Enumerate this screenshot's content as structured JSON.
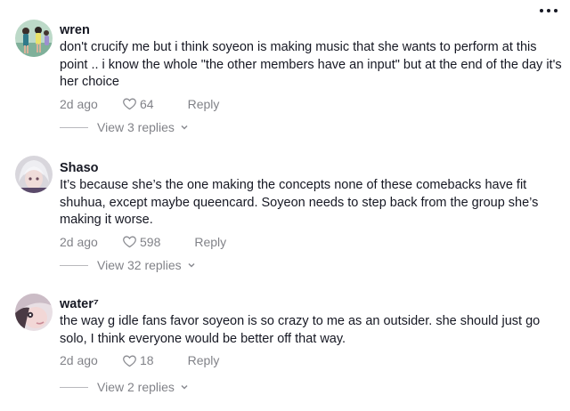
{
  "comments": [
    {
      "author": "wren",
      "text": "don't crucify me but i think soyeon is making music that she wants to perform at this point .. i know the whole \"the other members have an input\" but at the end of the day it's her choice",
      "time": "2d ago",
      "likes": "64",
      "reply_label": "Reply",
      "view_replies": "View 3 replies"
    },
    {
      "author": "Shaso",
      "text": "It’s because she’s the one making the concepts none of these comebacks have fit shuhua, except maybe queencard. Soyeon needs to step back from the group she’s making it worse.",
      "time": "2d ago",
      "likes": "598",
      "reply_label": "Reply",
      "view_replies": "View 32 replies"
    },
    {
      "author": "water⁷",
      "text": "the way g idle fans favor soyeon is so crazy to me as an outsider. she should just go solo, I think everyone would be better off that way.",
      "time": "2d ago",
      "likes": "18",
      "reply_label": "Reply",
      "view_replies": "View 2 replies"
    }
  ],
  "icons": {
    "like": "heart-outline-icon",
    "more": "more-options-icon",
    "expand": "chevron-down-icon"
  },
  "colors": {
    "text": "#161823",
    "secondary": "#8a8b91"
  }
}
